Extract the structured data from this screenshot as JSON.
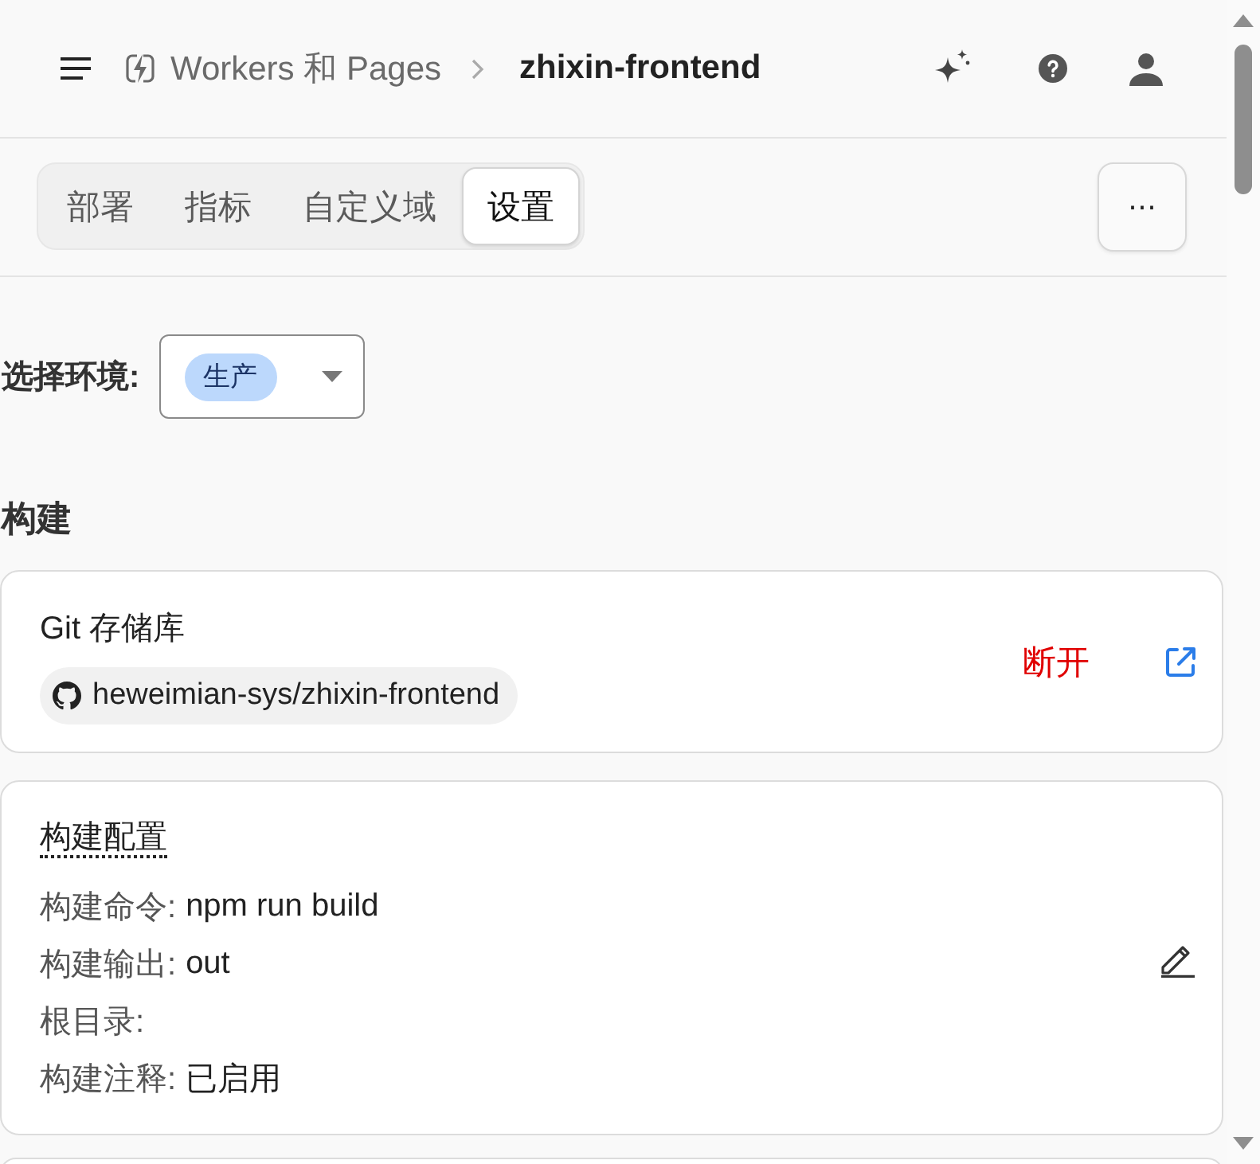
{
  "header": {
    "breadcrumb": [
      {
        "kind": "section",
        "label": "Workers 和 Pages"
      },
      {
        "kind": "current",
        "label": "zhixin-frontend"
      }
    ]
  },
  "tabs": [
    {
      "label": "部署",
      "selected": false
    },
    {
      "label": "指标",
      "selected": false
    },
    {
      "label": "自定义域",
      "selected": false
    },
    {
      "label": "设置",
      "selected": true
    }
  ],
  "more_button": {
    "label": "⋯"
  },
  "environment": {
    "label": "选择环境:",
    "value": "生产"
  },
  "build": {
    "heading": "构建",
    "repository": {
      "title": "Git 存储库",
      "repo": "heweimian-sys/zhixin-frontend",
      "action": "断开"
    },
    "config": {
      "title": "构建配置",
      "rows": [
        {
          "label": "构建命令:",
          "value": "npm run build"
        },
        {
          "label": "构建输出:",
          "value": "out"
        },
        {
          "label": "根目录:"
        },
        {
          "label": "构建注释:",
          "value": "已启用"
        }
      ]
    }
  }
}
